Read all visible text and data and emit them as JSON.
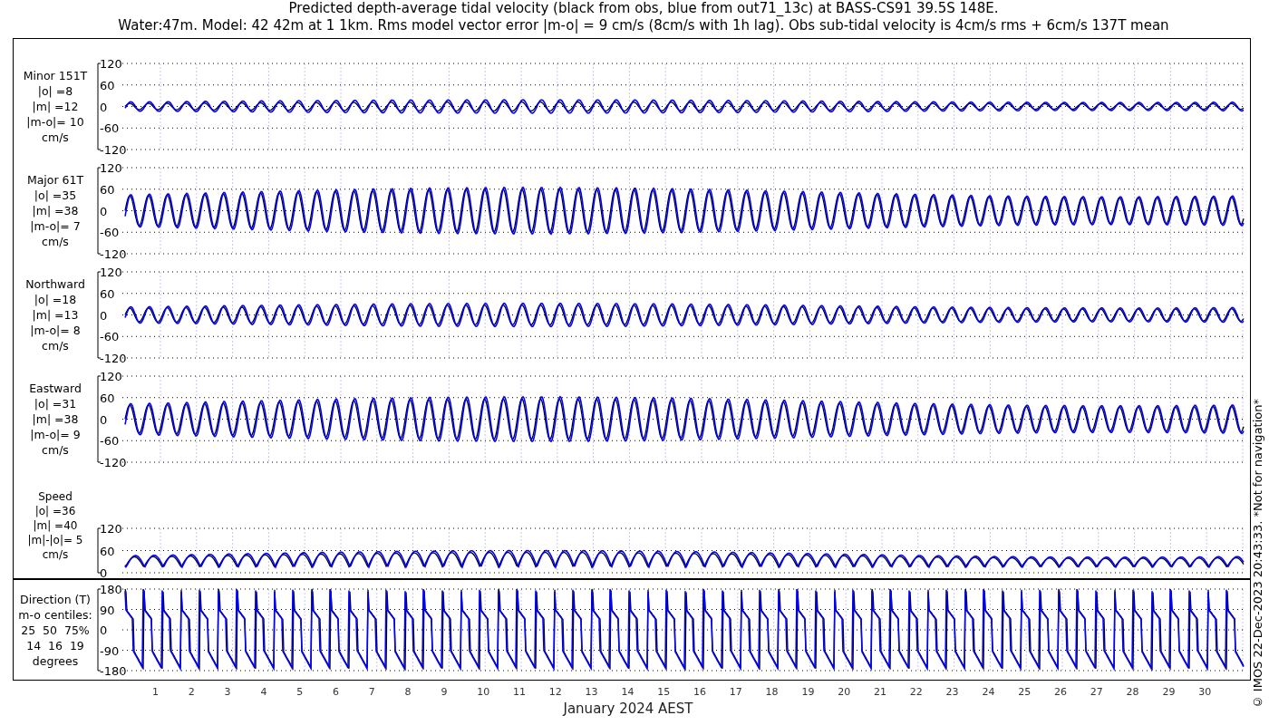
{
  "title_lines": [
    "Predicted depth-average tidal velocity (black from obs, blue from out71_13c) at BASS-CS91 39.5S 148E.",
    "Water:47m. Model: 42 42m at 1 1km. Rms model vector error |m-o| = 9 cm/s (8cm/s with 1h lag). Obs sub-tidal velocity is 4cm/s rms + 6cm/s 137T mean"
  ],
  "panels": [
    {
      "kind": "velocity",
      "label_lines": [
        "Minor 151T",
        "|o| =8",
        "|m| =12",
        "|m-o|= 10",
        "cm/s"
      ],
      "yticks": [
        "120",
        "60",
        "0",
        "-60",
        "-120"
      ]
    },
    {
      "kind": "velocity",
      "label_lines": [
        "Major 61T",
        "|o| =35",
        "|m| =38",
        "|m-o|= 7",
        "cm/s"
      ],
      "yticks": [
        "120",
        "60",
        "0",
        "-60",
        "-120"
      ]
    },
    {
      "kind": "velocity",
      "label_lines": [
        "Northward",
        "|o| =18",
        "|m| =13",
        "|m-o|= 8",
        "cm/s"
      ],
      "yticks": [
        "120",
        "60",
        "0",
        "-60",
        "-120"
      ]
    },
    {
      "kind": "velocity",
      "label_lines": [
        "Eastward",
        "|o| =31",
        "|m| =38",
        "|m-o|= 9",
        "cm/s"
      ],
      "yticks": [
        "120",
        "60",
        "0",
        "-60",
        "-120"
      ]
    },
    {
      "kind": "speed",
      "label_lines": [
        "Speed",
        "|o| =36",
        "|m| =40",
        "|m|-|o|= 5",
        "cm/s"
      ],
      "yticks": [
        "120",
        "60",
        "0"
      ]
    },
    {
      "kind": "direction",
      "label_lines": [
        "Direction (T)",
        "m-o centiles:",
        "25  50  75%",
        "14  16  19",
        "degrees"
      ],
      "yticks": [
        "180",
        "90",
        "0",
        "-90",
        "-180"
      ]
    }
  ],
  "day_labels": [
    "1",
    "2",
    "3",
    "4",
    "5",
    "6",
    "7",
    "8",
    "9",
    "10",
    "11",
    "12",
    "13",
    "14",
    "15",
    "16",
    "17",
    "18",
    "19",
    "20",
    "21",
    "22",
    "23",
    "24",
    "25",
    "26",
    "27",
    "28",
    "29",
    "30"
  ],
  "xlabel": "January 2024 AEST",
  "footer": "© IMOS 22-Dec-2023 20:43:33. *Not for navigation*"
}
